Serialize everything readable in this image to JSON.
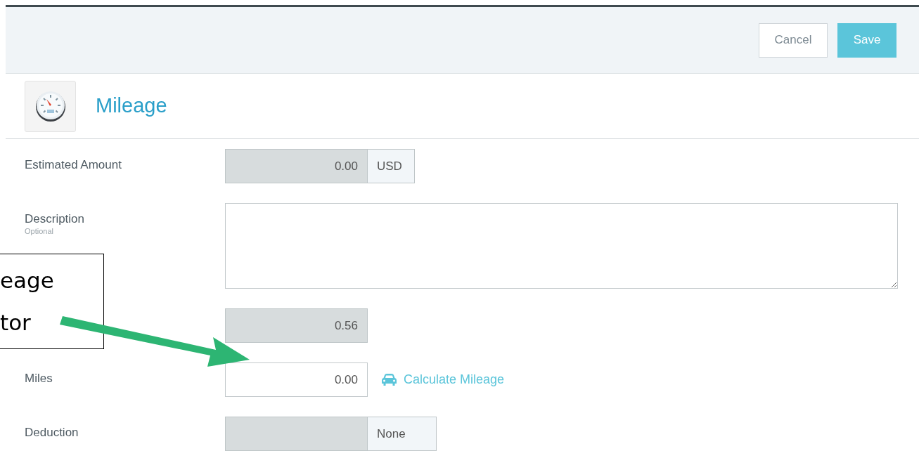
{
  "toolbar": {
    "buttons": [
      {
        "label": "Cancel",
        "kind": "secondary"
      },
      {
        "label": "Save",
        "kind": "primary"
      }
    ]
  },
  "header": {
    "title": "Mileage"
  },
  "fields": [
    {
      "kind": "amount",
      "label": "Estimated Amount",
      "value": "0.00",
      "addon": "USD",
      "disabled": true
    },
    {
      "kind": "textarea",
      "label": "Description",
      "hint": "Optional"
    },
    {
      "kind": "amount",
      "value": "0.56",
      "disabled": true
    },
    {
      "kind": "amount",
      "label": "Miles",
      "value": "0.00",
      "disabled": false,
      "link": "Calculate Mileage"
    },
    {
      "kind": "amount",
      "label": "Deduction",
      "addon": "None",
      "disabled": true
    }
  ],
  "callout": {
    "lines": [
      "eage",
      "tor"
    ]
  }
}
